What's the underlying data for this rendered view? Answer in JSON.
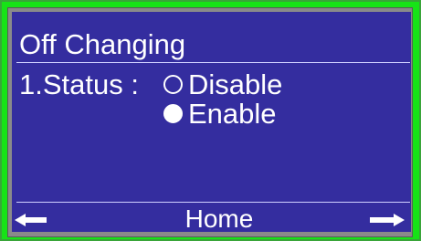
{
  "screen": {
    "title": "Off Changing",
    "status_label": "1.Status :",
    "options": [
      {
        "label": "Disable",
        "selected": false
      },
      {
        "label": "Enable",
        "selected": true
      }
    ],
    "footer": {
      "left_icon": "left-arrow-icon",
      "home_label": "Home",
      "right_icon": "right-arrow-icon"
    },
    "colors": {
      "background": "#342d9f",
      "text": "#ffffff",
      "frame": "#17e317"
    }
  }
}
